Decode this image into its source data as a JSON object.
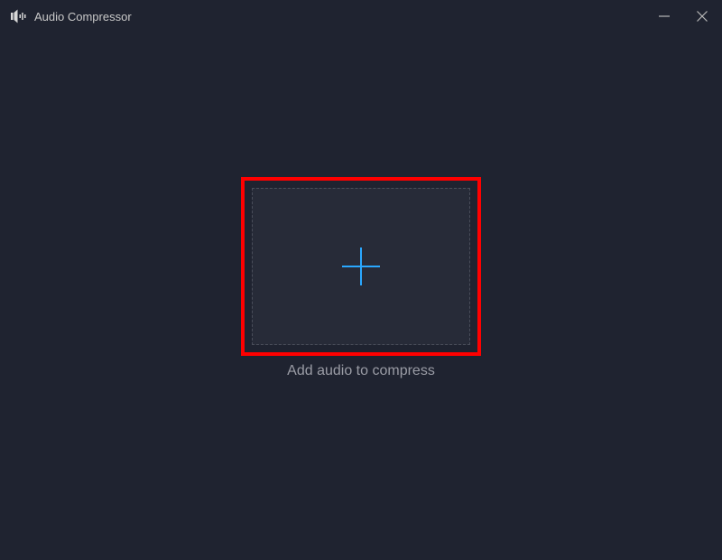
{
  "titlebar": {
    "app_title": "Audio Compressor"
  },
  "main": {
    "instruction": "Add audio to compress"
  },
  "icons": {
    "app": "audio-compressor-icon",
    "minimize": "minimize-icon",
    "close": "close-icon",
    "plus": "plus-icon"
  },
  "colors": {
    "background": "#1f2330",
    "dropzone_bg": "#272b38",
    "dropzone_border": "#4a4e5a",
    "highlight": "#ff0000",
    "plus": "#2aa8ff",
    "text_primary": "#c8c8c8",
    "text_secondary": "#9a9ca5"
  }
}
